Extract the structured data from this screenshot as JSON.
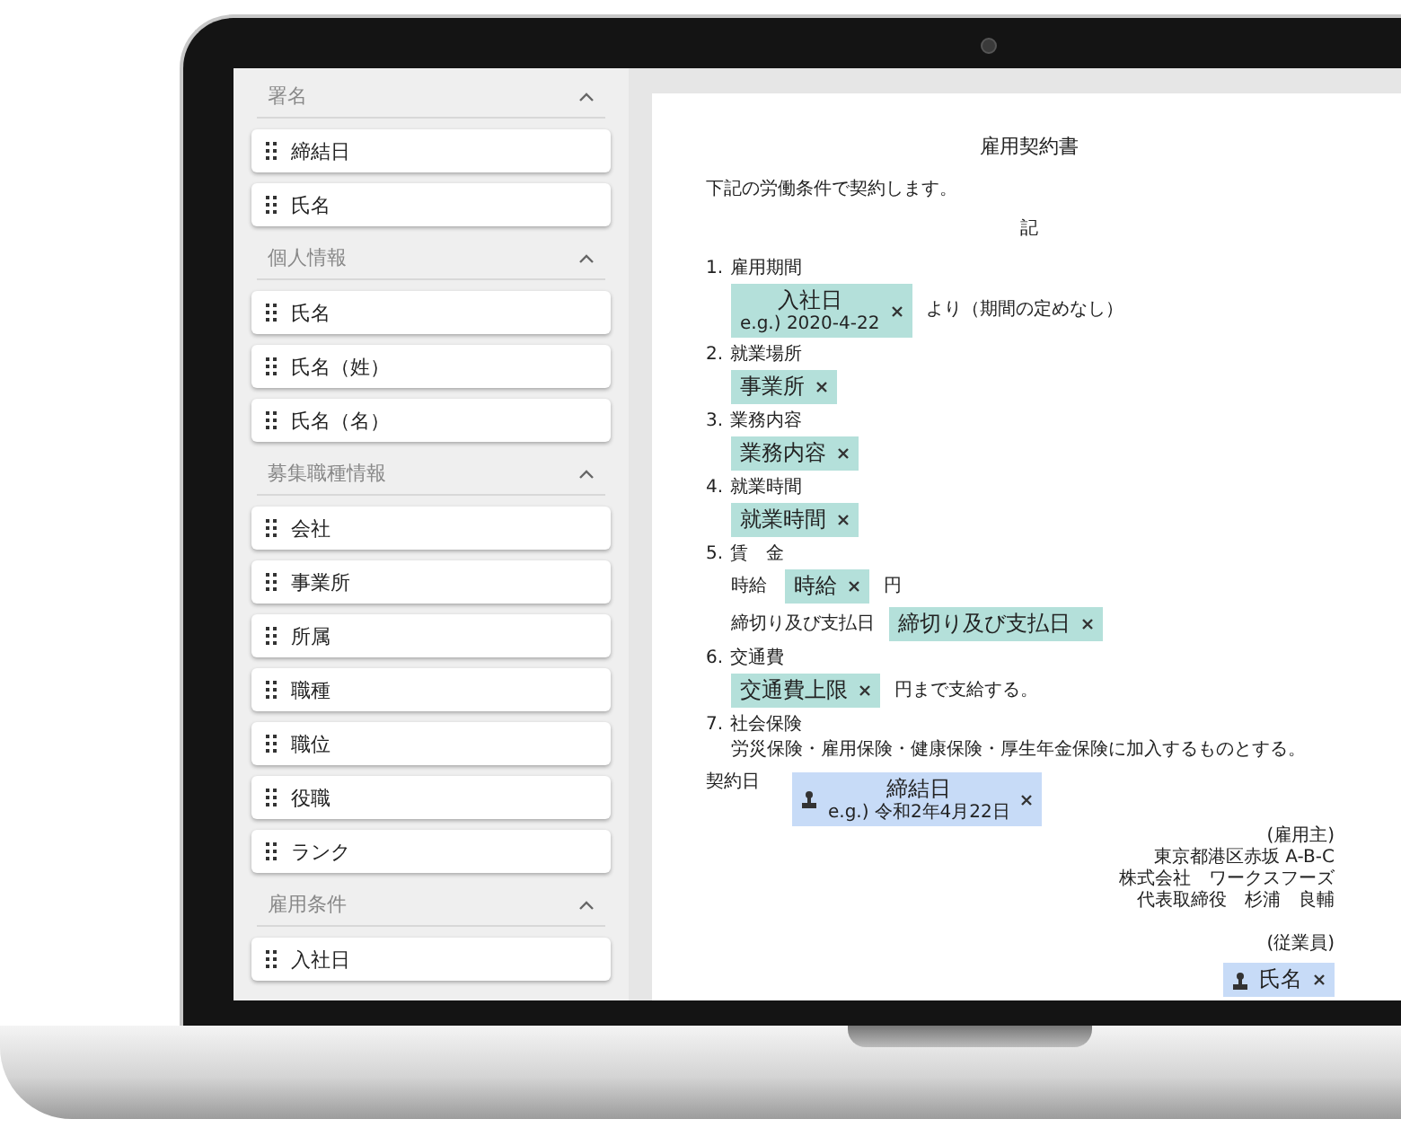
{
  "sidebar": {
    "sections": [
      {
        "title": "署名",
        "expanded": true,
        "items": [
          {
            "label": "締結日"
          },
          {
            "label": "氏名"
          }
        ]
      },
      {
        "title": "個人情報",
        "expanded": true,
        "items": [
          {
            "label": "氏名"
          },
          {
            "label": "氏名（姓）"
          },
          {
            "label": "氏名（名）"
          }
        ]
      },
      {
        "title": "募集職種情報",
        "expanded": true,
        "items": [
          {
            "label": "会社"
          },
          {
            "label": "事業所"
          },
          {
            "label": "所属"
          },
          {
            "label": "職種"
          },
          {
            "label": "職位"
          },
          {
            "label": "役職"
          },
          {
            "label": "ランク"
          }
        ]
      },
      {
        "title": "雇用条件",
        "expanded": true,
        "items": [
          {
            "label": "入社日"
          }
        ]
      }
    ]
  },
  "document": {
    "title": "雇用契約書",
    "intro": "下記の労働条件で契約します。",
    "center_mark": "記",
    "clauses": [
      {
        "number": "1.",
        "heading": "雇用期間",
        "lines": [
          [
            {
              "kind": "chip",
              "label": "入社日",
              "hint": "e.g.) 2020-4-22"
            },
            {
              "kind": "text",
              "text": "より（期間の定めなし）"
            }
          ]
        ]
      },
      {
        "number": "2.",
        "heading": "就業場所",
        "lines": [
          [
            {
              "kind": "chip",
              "label": "事業所"
            }
          ]
        ]
      },
      {
        "number": "3.",
        "heading": "業務内容",
        "lines": [
          [
            {
              "kind": "chip",
              "label": "業務内容"
            }
          ]
        ]
      },
      {
        "number": "4.",
        "heading": "就業時間",
        "lines": [
          [
            {
              "kind": "chip",
              "label": "就業時間"
            }
          ]
        ]
      },
      {
        "number": "5.",
        "heading": "賃　金",
        "lines": [
          [
            {
              "kind": "sublabel",
              "text": "時給"
            },
            {
              "kind": "chip",
              "label": "時給"
            },
            {
              "kind": "text",
              "text": "円"
            }
          ],
          [
            {
              "kind": "sublabel",
              "text": "締切り及び支払日"
            },
            {
              "kind": "chip",
              "label": "締切り及び支払日"
            }
          ]
        ]
      },
      {
        "number": "6.",
        "heading": "交通費",
        "lines": [
          [
            {
              "kind": "chip",
              "label": "交通費上限"
            },
            {
              "kind": "text",
              "text": "円まで支給する。"
            }
          ]
        ]
      },
      {
        "number": "7.",
        "heading": "社会保険",
        "lines": [
          [
            {
              "kind": "text",
              "text": "労災保険・雇用保険・健康保険・厚生年金保険に加入するものとする。"
            }
          ]
        ]
      }
    ],
    "contract_date": {
      "label": "契約日",
      "chip": {
        "kind": "signer_chip",
        "label": "締結日",
        "hint": "e.g.) 令和2年4月22日"
      }
    },
    "employer": {
      "heading": "(雇用主)",
      "lines": [
        "東京都港区赤坂 A-B-C",
        "株式会社　ワークスフーズ",
        "代表取締役　杉浦　良輔"
      ]
    },
    "employee": {
      "heading": "(従業員)",
      "chip": {
        "kind": "signer_chip",
        "label": "氏名"
      }
    }
  }
}
